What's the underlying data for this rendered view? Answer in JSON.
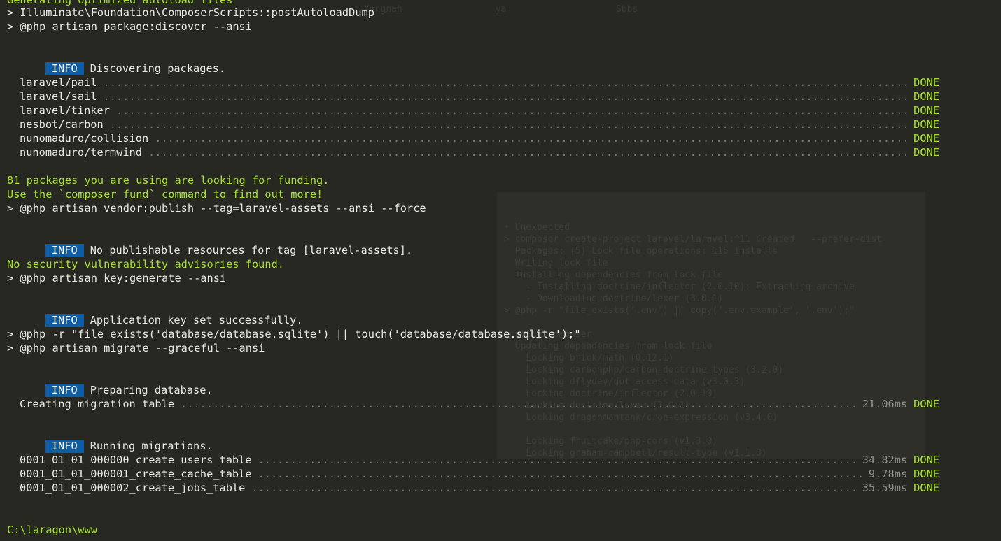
{
  "top_line": "Generating optimized autoload files",
  "ghost": {
    "top": "Xangnah                 ya                    Sbbs",
    "panel": [
      "• Unexpected",
      "> composer create-project laravel/laravel:^11 Created   --prefer-dist",
      "  Packages: (5) Lock file operations: 115 installs",
      "  Writing lock file",
      "  Installing dependencies from lock file",
      "    - Installing doctrine/inflector (2.0.10): Extracting archive",
      "    - Downloading doctrine/lexer (3.0.1)",
      "> @php -r \"file_exists('.env') || copy('.env.example', '.env');\"",
      "",
      "Loading composer",
      "  Updating dependencies from lock file",
      "    Locking brick/math (0.12.1)",
      "    Locking carbonphp/carbon-doctrine-types (3.2.0)",
      "    Locking dflydev/dot-access-data (v3.0.3)",
      "    Locking doctrine/inflector (2.0.10)",
      "    Locking doctrine/lexer (3.0.1)",
      "    Locking dragonmantank/cron-expression (v3.4.0)",
      "",
      "    Locking fruitcake/php-cors (v1.3.0)",
      "    Locking graham-campbell/result-type (v1.1.3)",
      "    Locking guzzlehttp/guzzle (7.9.2)",
      "    Locking guzzlehttp/promises (2.0.4)"
    ]
  },
  "lines": {
    "post_autoload": "> Illuminate\\Foundation\\ComposerScripts::postAutoloadDump",
    "package_discover": "> @php artisan package:discover --ansi",
    "funding_1": "81 packages you are using are looking for funding.",
    "funding_2": "Use the `composer fund` command to find out more!",
    "vendor_publish": "> @php artisan vendor:publish --tag=laravel-assets --ansi --force",
    "no_vuln": "No security vulnerability advisories found.",
    "key_generate": "> @php artisan key:generate --ansi",
    "sqlite_touch": "> @php -r \"file_exists('database/database.sqlite') || touch('database/database.sqlite');\"",
    "migrate": "> @php artisan migrate --graceful --ansi",
    "prompt": "C:\\laragon\\www"
  },
  "info": {
    "badge": "INFO",
    "discovering": "Discovering packages.",
    "no_publishable": "No publishable resources for tag [laravel-assets].",
    "key_set": "Application key set successfully.",
    "preparing": "Preparing database.",
    "running": "Running migrations."
  },
  "packages": [
    {
      "name": "laravel/pail",
      "status": "DONE"
    },
    {
      "name": "laravel/sail",
      "status": "DONE"
    },
    {
      "name": "laravel/tinker",
      "status": "DONE"
    },
    {
      "name": "nesbot/carbon",
      "status": "DONE"
    },
    {
      "name": "nunomaduro/collision",
      "status": "DONE"
    },
    {
      "name": "nunomaduro/termwind",
      "status": "DONE"
    }
  ],
  "migration_table": {
    "name": "Creating migration table",
    "time": "21.06ms",
    "status": "DONE"
  },
  "migrations": [
    {
      "name": "0001_01_01_000000_create_users_table",
      "time": "34.82ms",
      "status": "DONE"
    },
    {
      "name": "0001_01_01_000001_create_cache_table",
      "time": "9.78ms",
      "status": "DONE"
    },
    {
      "name": "0001_01_01_000002_create_jobs_table",
      "time": "35.59ms",
      "status": "DONE"
    }
  ],
  "colors": {
    "background": "#272822",
    "text": "#e8e8e2",
    "green": "#a6e22e",
    "info_badge": "#0d5ca6",
    "dots": "#75766d"
  }
}
